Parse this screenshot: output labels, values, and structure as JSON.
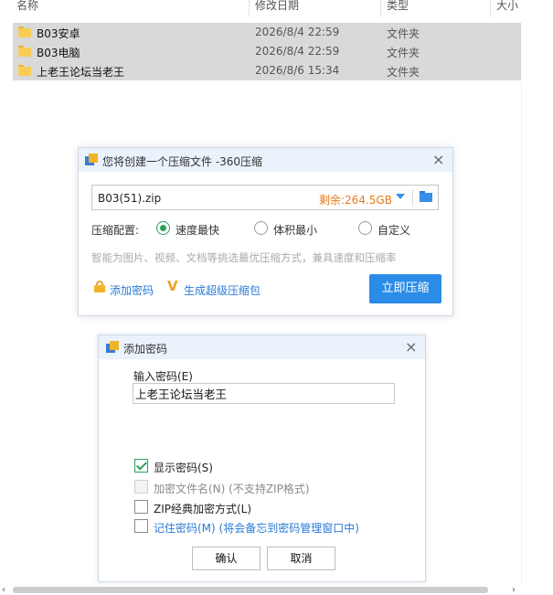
{
  "explorer": {
    "columns": [
      "名称",
      "修改日期",
      "类型",
      "大小"
    ],
    "files": [
      {
        "name": "B03安卓",
        "date": "2026/8/4 22:59",
        "type": "文件夹"
      },
      {
        "name": "B03电脑",
        "date": "2026/8/4 22:59",
        "type": "文件夹"
      },
      {
        "name": "上老王论坛当老王",
        "date": "2026/8/6 15:34",
        "type": "文件夹"
      }
    ]
  },
  "compress_dialog": {
    "title": "您将创建一个压缩文件 -360压缩",
    "close": "×",
    "filename": "B03(51).zip",
    "remaining": "剩余:264.5GB",
    "config_label": "压缩配置:",
    "options": [
      "速度最快",
      "体积最小",
      "自定义"
    ],
    "selected_option": "速度最快",
    "hint": "智能为图片、视频、文档等挑选最优压缩方式，兼具速度和压缩率",
    "add_password": "添加密码",
    "super_package": "生成超级压缩包",
    "compress_now": "立即压缩"
  },
  "password_dialog": {
    "title": "添加密码",
    "close": "×",
    "input_label": "输入密码(E)",
    "password_value": "上老王论坛当老王",
    "show_password": "显示密码(S)",
    "show_password_checked": true,
    "encrypt_filenames": "加密文件名(N)  (不支持ZIP格式)",
    "zip_classic": "ZIP经典加密方式(L)",
    "remember_password": "记住密码(M) (将会备忘到密码管理窗口中)",
    "ok": "确认",
    "cancel": "取消"
  },
  "scrollbar": {
    "left_arrow": "‹",
    "right_arrow": "›"
  },
  "colors": {
    "accent_blue": "#2b8ce8",
    "remaining_orange": "#e8791a",
    "check_green": "#2aa05a",
    "row_selected": "#d9d9d9"
  }
}
